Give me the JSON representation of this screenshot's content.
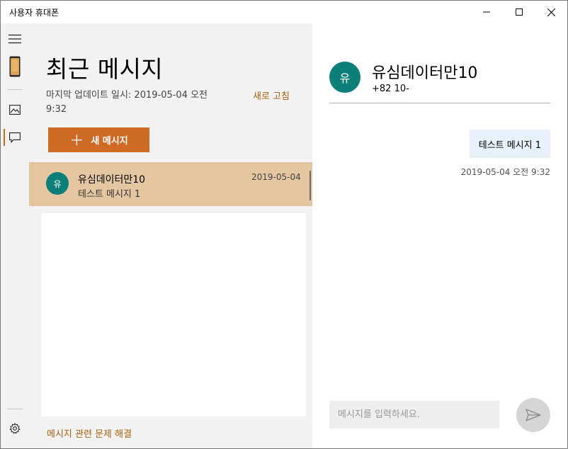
{
  "app": {
    "title": "사용자 휴대폰"
  },
  "window_controls": {
    "minimize": "minimize-icon",
    "maximize": "maximize-icon",
    "close": "close-icon"
  },
  "rail": {
    "icons": [
      "hamburger-menu-icon",
      "phone-icon",
      "photos-icon",
      "messages-icon",
      "settings-gear-icon"
    ],
    "active": "messages"
  },
  "list": {
    "heading": "최근 메시지",
    "last_updated": "마지막 업데이트 일시: 2019-05-04 오전 9:32",
    "refresh_label": "새로 고침",
    "new_message_label": "새 메시지",
    "conversations": [
      {
        "avatar_initial": "유",
        "name": "유심데이터만10",
        "preview": "테스트 메시지 1",
        "date": "2019-05-04"
      }
    ],
    "troubleshoot_label": "메시지 관련 문제 해결"
  },
  "conversation": {
    "avatar_initial": "유",
    "name": "유심데이터만10",
    "phone": "+82 10-",
    "messages": [
      {
        "text": "테스트 메시지 1",
        "timestamp": "2019-05-04 오전 9:32"
      }
    ],
    "input_placeholder": "메시지를 입력하세요."
  },
  "colors": {
    "accent": "#cf6a24",
    "link": "#a9620f",
    "avatar": "#0b7f78",
    "selected_row": "#e4c7a0",
    "bubble": "#e8f0fa"
  }
}
